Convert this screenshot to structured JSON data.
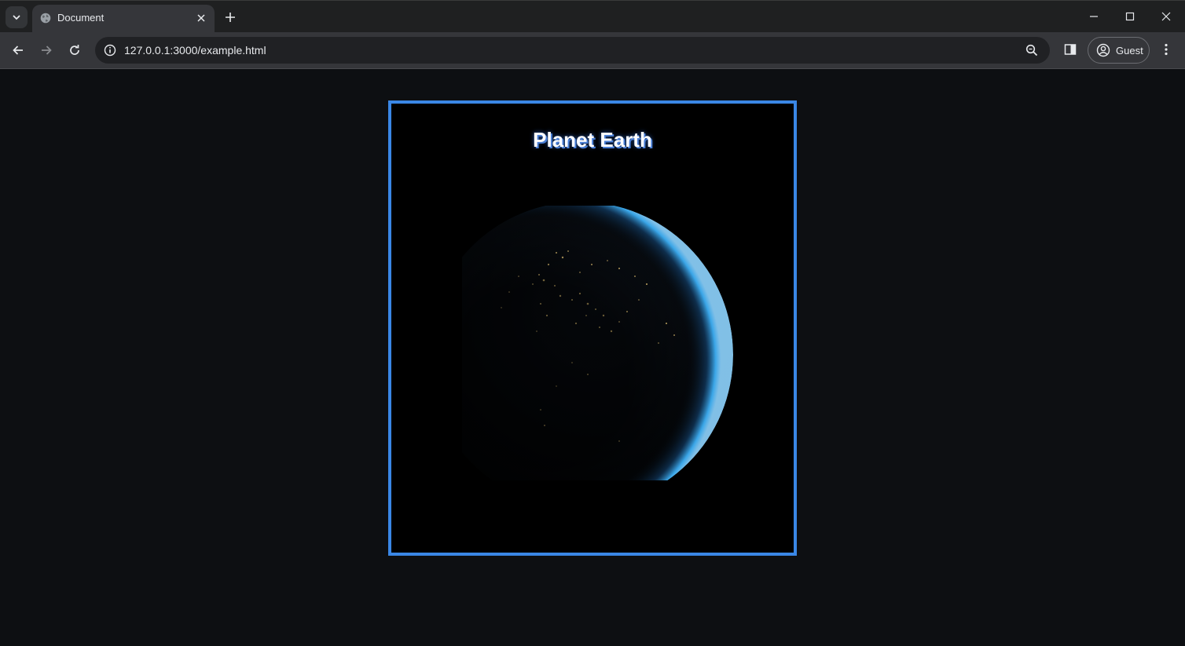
{
  "browser": {
    "tab": {
      "title": "Document",
      "favicon": "globe-icon"
    },
    "url": "127.0.0.1:3000/example.html",
    "profile_label": "Guest",
    "colors": {
      "frame_border": "#3a87e6",
      "tab_bg": "#35363a",
      "titlebar_bg": "#1f2021",
      "page_bg": "#0d0f12"
    }
  },
  "page": {
    "title": "Planet Earth",
    "image_subject": "earth-at-night"
  }
}
